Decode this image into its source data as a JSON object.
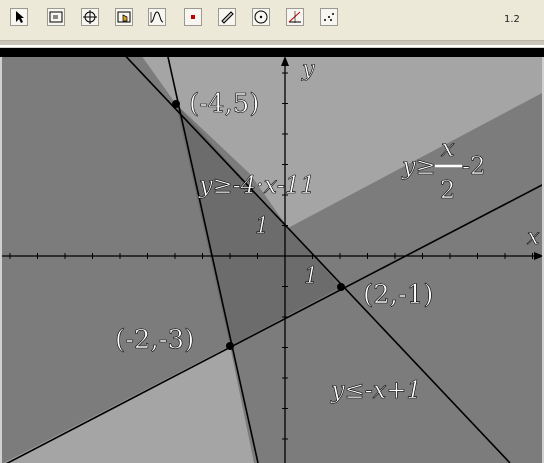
{
  "toolbar": {
    "tools": [
      {
        "icon": "pointer-icon"
      },
      {
        "icon": "window-zoom-icon"
      },
      {
        "icon": "graph-axes-icon"
      },
      {
        "icon": "hand-tool-icon"
      },
      {
        "icon": "function-trace-icon"
      },
      {
        "icon": "point-icon"
      },
      {
        "icon": "ruler-icon"
      },
      {
        "icon": "circle-icon"
      },
      {
        "icon": "angle-icon"
      },
      {
        "icon": "scatter-plot-icon"
      }
    ],
    "page_label": "1.2"
  },
  "graph": {
    "x_axis_label": "x",
    "y_axis_label": "y",
    "x_unit_label": "1",
    "y_unit_label": "1",
    "colors": {
      "outer": "#7c7c7c",
      "triangle": "#6c6c6c",
      "light_region": "#a5a5a5",
      "lines": "#000000"
    },
    "inequalities": [
      {
        "text": "y≥-4·x-11"
      },
      {
        "text": "y≥x/2-2",
        "lhs": "y≥",
        "num": "x",
        "den": "2",
        "tail": "-2"
      },
      {
        "text": "y≤-x+1"
      }
    ],
    "vertices": [
      {
        "label": "(-4,5)",
        "x": -4,
        "y": 5
      },
      {
        "label": "(2,-1)",
        "x": 2,
        "y": -1
      },
      {
        "label": "(-2,-3)",
        "x": -2,
        "y": -3
      }
    ]
  }
}
